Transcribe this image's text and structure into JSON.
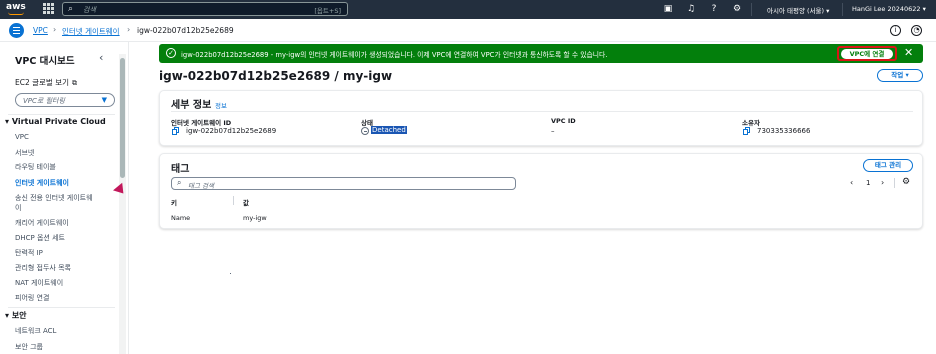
{
  "topnav": {
    "logo": "aws",
    "search_placeholder": "검색",
    "search_hint": "[옵트+S]",
    "region": "아시아 태평양 (서울)",
    "account": "HanGi Lee 20240622",
    "icons": [
      "cloudshell-icon",
      "bell-icon",
      "help-icon",
      "gear-icon"
    ]
  },
  "breadcrumb": {
    "items": [
      "VPC",
      "인터넷 게이트웨이",
      "igw-022b07d12b25e2689"
    ]
  },
  "sidebar": {
    "title": "VPC 대시보드",
    "ec2_link": "EC2 글로벌 보기",
    "filter_placeholder": "VPC로 필터링",
    "sections": [
      {
        "title": "Virtual Private Cloud",
        "items": [
          "VPC",
          "서브넷",
          "라우팅 테이블",
          "인터넷 게이트웨이",
          "송신 전용 인터넷 게이트웨",
          "이",
          "캐리어 게이트웨이",
          "DHCP 옵션 세트",
          "탄력적 IP",
          "관리형 접두사 목록",
          "NAT 게이트웨이",
          "피어링 연결"
        ]
      },
      {
        "title": "보안",
        "items": [
          "네트워크 ACL",
          "보안 그룹"
        ]
      }
    ],
    "active_item": "인터넷 게이트웨이"
  },
  "flash": {
    "message": "igw-022b07d12b25e2689 - my-igw의 인터넷 게이트웨이가 생성되었습니다. 이제 VPC에 연결하여 VPC가 인터넷과 통신하도록 할 수 있습니다.",
    "action_label": "VPC에 연결",
    "color": "#037f0c"
  },
  "page": {
    "title": "igw-022b07d12b25e2689 / my-igw",
    "actions_label": "작업"
  },
  "details": {
    "title": "세부 정보",
    "info_link": "정보",
    "fields": [
      {
        "label": "인터넷 게이트웨이 ID",
        "value": "igw-022b07d12b25e2689"
      },
      {
        "label": "상태",
        "value": "Detached"
      },
      {
        "label": "VPC ID",
        "value": "–"
      },
      {
        "label": "소유자",
        "value": "730335336666"
      }
    ]
  },
  "tags": {
    "title": "태그",
    "manage_label": "태그 관리",
    "search_placeholder": "태그 검색",
    "page": "1",
    "columns": [
      "키",
      "값"
    ],
    "rows": [
      {
        "key": "Name",
        "value": "my-igw"
      }
    ]
  },
  "colors": {
    "nav_bg": "#232f3e",
    "link": "#0972d3",
    "success": "#037f0c",
    "highlight_border": "#d91515"
  }
}
